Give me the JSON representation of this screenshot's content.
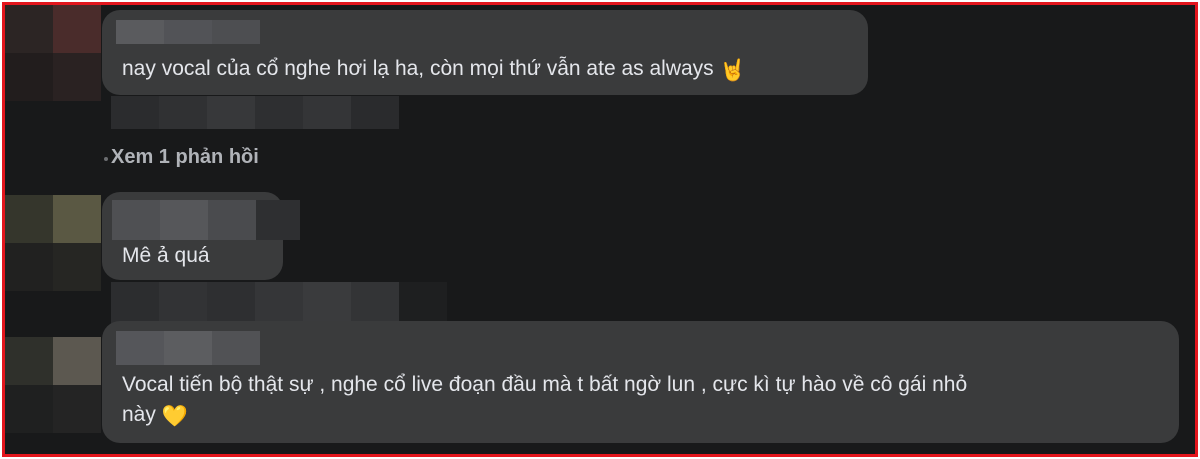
{
  "comments": [
    {
      "author": "",
      "text": "nay vocal của cổ nghe hơi lạ ha, còn mọi thứ vẫn ate as always",
      "emoji": "🤘"
    },
    {
      "author": "",
      "text": "Mê ả quá",
      "emoji": ""
    },
    {
      "author": "",
      "text_line1": "Vocal tiến bộ thật sự , nghe cổ live đoạn đầu mà t bất ngờ lun , cực kì tự hào về cô gái nhỏ",
      "text_line2": "này",
      "emoji": "💛"
    }
  ],
  "replies_link": "Xem 1 phản hồi",
  "colors": {
    "frame_border": "#e3161d",
    "background": "#18191a",
    "bubble": "#3a3b3c",
    "text": "#e4e6eb",
    "secondary_text": "#b0b3b8"
  }
}
